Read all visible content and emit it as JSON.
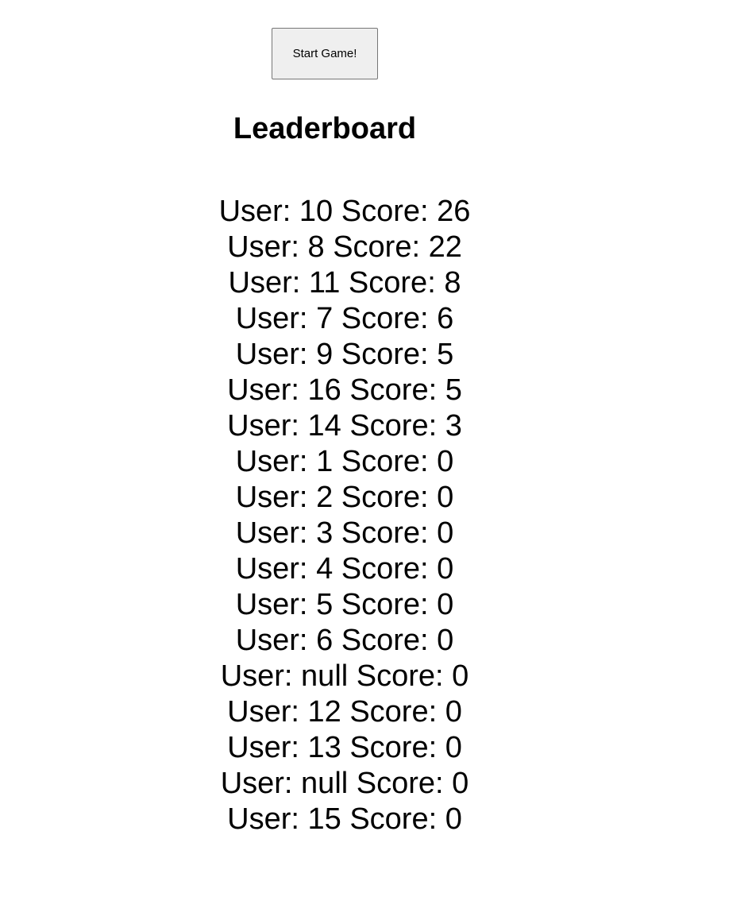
{
  "start_button_label": "Start Game!",
  "leaderboard_title": "Leaderboard",
  "entries": [
    {
      "user": "10",
      "score": "26"
    },
    {
      "user": "8",
      "score": "22"
    },
    {
      "user": "11",
      "score": "8"
    },
    {
      "user": "7",
      "score": "6"
    },
    {
      "user": "9",
      "score": "5"
    },
    {
      "user": "16",
      "score": "5"
    },
    {
      "user": "14",
      "score": "3"
    },
    {
      "user": "1",
      "score": "0"
    },
    {
      "user": "2",
      "score": "0"
    },
    {
      "user": "3",
      "score": "0"
    },
    {
      "user": "4",
      "score": "0"
    },
    {
      "user": "5",
      "score": "0"
    },
    {
      "user": "6",
      "score": "0"
    },
    {
      "user": "null",
      "score": "0"
    },
    {
      "user": "12",
      "score": "0"
    },
    {
      "user": "13",
      "score": "0"
    },
    {
      "user": "null",
      "score": "0"
    },
    {
      "user": "15",
      "score": "0"
    }
  ],
  "row_labels": {
    "user_prefix": "User:",
    "score_prefix": "Score:"
  }
}
